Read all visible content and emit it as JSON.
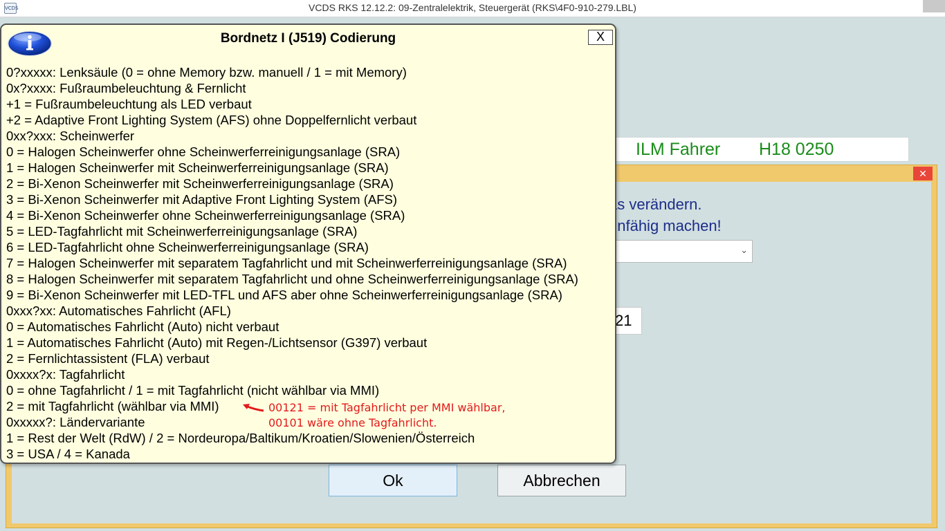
{
  "window": {
    "icon_label": "VCDS",
    "title": "VCDS RKS 12.12.2: 09-Zentralelektrik,  Steuergerät (RKS\\4F0-910-279.LBL)"
  },
  "background": {
    "ilm_label": "ILM Fahrer",
    "ilm_code": "H18 0250",
    "warning_line1": "as verändern.",
    "warning_line2": "unfähig machen!",
    "coding_value": "21",
    "ok_label": "Ok",
    "cancel_label": "Abbrechen"
  },
  "popup": {
    "title": "Bordnetz I (J519) Codierung",
    "close_label": "X",
    "lines": [
      "0?xxxxx: Lenksäule (0 = ohne Memory bzw. manuell / 1 = mit Memory)",
      "0x?xxxx: Fußraumbeleuchtung & Fernlicht",
      "+1 = Fußraumbeleuchtung als LED verbaut",
      "+2 = Adaptive Front Lighting System (AFS) ohne Doppelfernlicht verbaut",
      "0xx?xxx: Scheinwerfer",
      "0 = Halogen Scheinwerfer ohne Scheinwerferreinigungsanlage (SRA)",
      "1 = Halogen Scheinwerfer mit Scheinwerferreinigungsanlage (SRA)",
      "2 = Bi-Xenon Scheinwerfer mit Scheinwerferreinigungsanlage (SRA)",
      "3 = Bi-Xenon Scheinwerfer mit Adaptive Front Lighting System (AFS)",
      "4 = Bi-Xenon Scheinwerfer ohne Scheinwerferreinigungsanlage (SRA)",
      "5 = LED-Tagfahrlicht mit Scheinwerferreinigungsanlage (SRA)",
      "6 = LED-Tagfahrlicht ohne Scheinwerferreinigungsanlage (SRA)",
      "7 = Halogen Scheinwerfer mit separatem Tagfahrlicht und mit Scheinwerferreinigungsanlage (SRA)",
      "8 = Halogen Scheinwerfer mit separatem Tagfahrlicht und ohne Scheinwerferreinigungsanlage (SRA)",
      "9 = Bi-Xenon Scheinwerfer mit LED-TFL und AFS aber ohne Scheinwerferreinigungsanlage (SRA)",
      "0xxx?xx: Automatisches Fahrlicht (AFL)",
      "0 = Automatisches Fahrlicht (Auto) nicht verbaut",
      "1 = Automatisches Fahrlicht (Auto) mit Regen-/Lichtsensor (G397) verbaut",
      "2 = Fernlichtassistent (FLA) verbaut",
      "0xxxx?x: Tagfahrlicht",
      "0 = ohne Tagfahrlicht / 1 = mit Tagfahrlicht (nicht wählbar via MMI)",
      "2 = mit Tagfahrlicht (wählbar via MMI)",
      "0xxxxx?: Ländervariante",
      "1 = Rest der Welt (RdW) / 2 = Nordeuropa/Baltikum/Kroatien/Slowenien/Österreich",
      "3 = USA / 4 = Kanada"
    ],
    "annotation_line1": "00121 = mit Tagfahrlicht per MMI wählbar,",
    "annotation_line2": "00101 wäre ohne Tagfahrlicht."
  },
  "colors": {
    "annotation": "#e21a1a",
    "ilm_green": "#1a8c1a",
    "warning_blue": "#1c2d8a",
    "popup_bg": "#ffffe0"
  }
}
